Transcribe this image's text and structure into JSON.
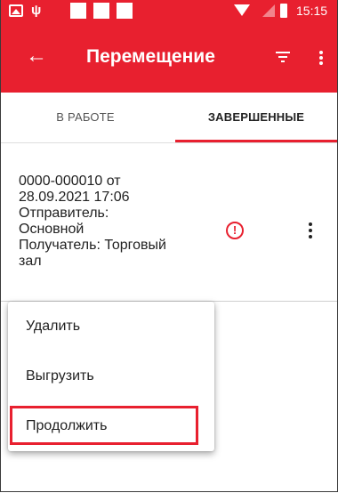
{
  "status_bar": {
    "time": "15:15",
    "icons": [
      "image-icon",
      "usb-icon",
      "wifi-icon",
      "signal-icon",
      "battery-icon"
    ],
    "background": "#e8202f"
  },
  "app_bar": {
    "title": "Перемещение",
    "back_icon": "arrow-back-icon",
    "filter_icon": "filter-icon",
    "more_icon": "more-vert-icon",
    "background": "#e8202f"
  },
  "tabs": [
    {
      "label": "В РАБОТЕ",
      "active": false
    },
    {
      "label": "ЗАВЕРШЕННЫЕ",
      "active": true
    }
  ],
  "document": {
    "number_line": "0000-000010 от",
    "date_line": "28.09.2021 17:06",
    "sender_label_line": "Отправитель:",
    "sender_value_line": "Основной",
    "receiver_line": "Получатель: Торговый",
    "receiver_cont_line": "зал",
    "warning_symbol": "!",
    "warning_icon": "warning-circle-icon",
    "more_icon": "more-vert-icon"
  },
  "context_menu": {
    "items": [
      {
        "label": "Удалить"
      },
      {
        "label": "Выгрузить"
      },
      {
        "label": "Продолжить",
        "highlighted": true
      }
    ],
    "highlight_color": "#e8202f"
  }
}
